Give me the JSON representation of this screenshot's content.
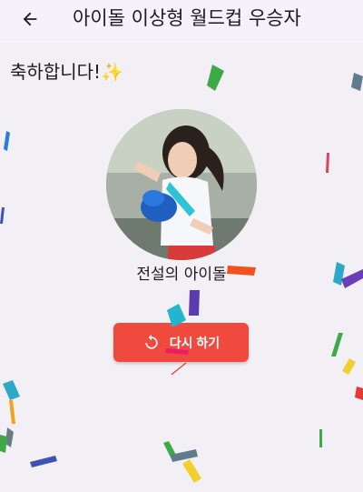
{
  "header": {
    "title": "아이돌 이상형 월드컵 우승자",
    "back_icon": "arrow-left-icon"
  },
  "main": {
    "congrats_text": "축하합니다!✨",
    "winner_name": "전설의 아이돌",
    "retry_label": "다시 하기",
    "retry_icon": "refresh-icon",
    "retry_color": "#f04a3e"
  }
}
